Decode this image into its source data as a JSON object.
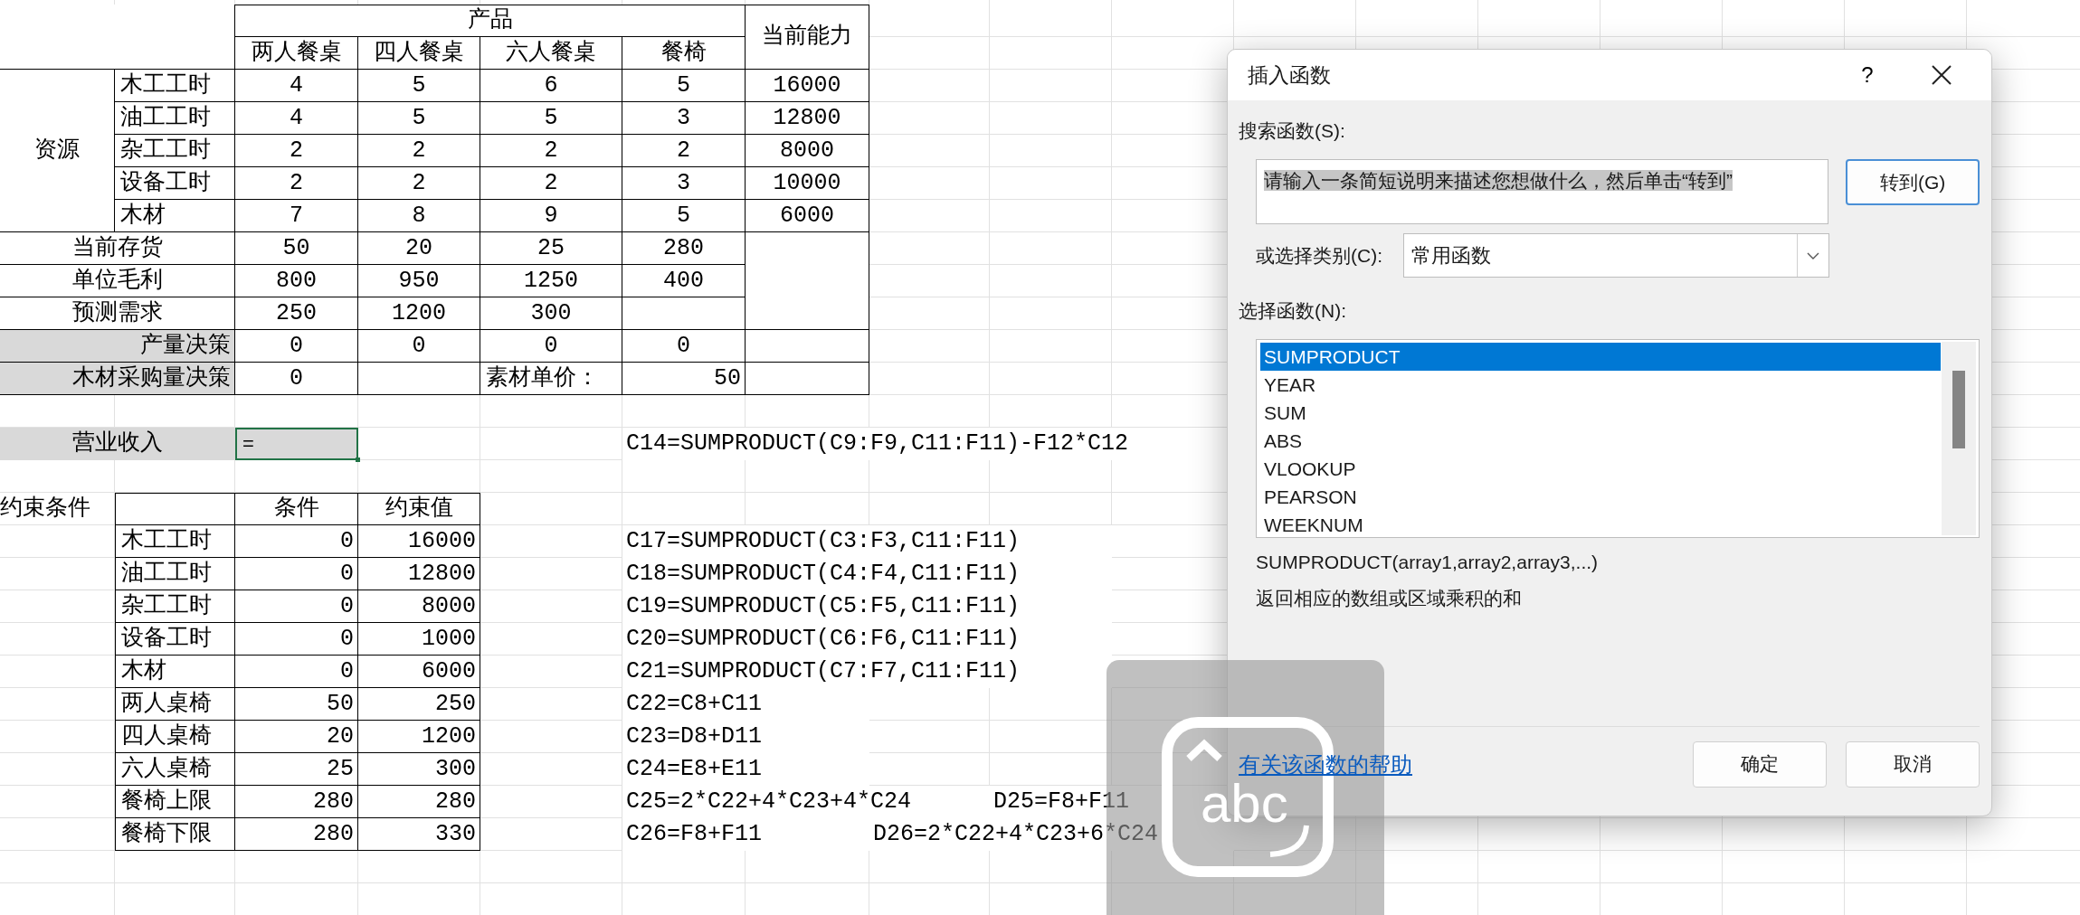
{
  "product_table": {
    "header_group": "产品",
    "capacity_header": "当前能力",
    "products": [
      "两人餐桌",
      "四人餐桌",
      "六人餐桌",
      "餐椅"
    ],
    "resource_group": "资源",
    "resources": [
      {
        "name": "木工工时",
        "values": [
          "4",
          "5",
          "6",
          "5"
        ],
        "capacity": "16000"
      },
      {
        "name": "油工工时",
        "values": [
          "4",
          "5",
          "5",
          "3"
        ],
        "capacity": "12800"
      },
      {
        "name": "杂工工时",
        "values": [
          "2",
          "2",
          "2",
          "2"
        ],
        "capacity": "8000"
      },
      {
        "name": "设备工时",
        "values": [
          "2",
          "2",
          "2",
          "3"
        ],
        "capacity": "10000"
      },
      {
        "name": "木材",
        "values": [
          "7",
          "8",
          "9",
          "5"
        ],
        "capacity": "6000"
      }
    ],
    "metrics": [
      {
        "name": "当前存货",
        "values": [
          "50",
          "20",
          "25",
          "280"
        ]
      },
      {
        "name": "单位毛利",
        "values": [
          "800",
          "950",
          "1250",
          "400"
        ]
      },
      {
        "name": "预测需求",
        "values": [
          "250",
          "1200",
          "300"
        ]
      }
    ],
    "decisions": [
      {
        "name": "产量决策",
        "values": [
          "0",
          "0",
          "0",
          "0"
        ]
      }
    ],
    "wood_purchase": {
      "name": "木材采购量决策",
      "value": "0",
      "price_label": "素材单价：",
      "price": "50"
    }
  },
  "revenue": {
    "label": "营业收入",
    "cell_value": "=",
    "active": true,
    "formula": "C14=SUMPRODUCT(C9:F9,C11:F11)-F12*C12"
  },
  "constraints": {
    "title": "约束条件",
    "columns": [
      "条件",
      "约束值"
    ],
    "rows": [
      {
        "name": "木工工时",
        "condition": "0",
        "limit": "16000",
        "formulas": [
          "C17=SUMPRODUCT(C3:F3,C11:F11)"
        ]
      },
      {
        "name": "油工工时",
        "condition": "0",
        "limit": "12800",
        "formulas": [
          "C18=SUMPRODUCT(C4:F4,C11:F11)"
        ]
      },
      {
        "name": "杂工工时",
        "condition": "0",
        "limit": "8000",
        "formulas": [
          "C19=SUMPRODUCT(C5:F5,C11:F11)"
        ]
      },
      {
        "name": "设备工时",
        "condition": "0",
        "limit": "1000",
        "formulas": [
          "C20=SUMPRODUCT(C6:F6,C11:F11)"
        ]
      },
      {
        "name": "木材",
        "condition": "0",
        "limit": "6000",
        "formulas": [
          "C21=SUMPRODUCT(C7:F7,C11:F11)"
        ]
      },
      {
        "name": "两人桌椅",
        "condition": "50",
        "limit": "250",
        "formulas": [
          "C22=C8+C11"
        ]
      },
      {
        "name": "四人桌椅",
        "condition": "20",
        "limit": "1200",
        "formulas": [
          "C23=D8+D11"
        ]
      },
      {
        "name": "六人桌椅",
        "condition": "25",
        "limit": "300",
        "formulas": [
          "C24=E8+E11"
        ]
      },
      {
        "name": "餐椅上限",
        "condition": "280",
        "limit": "280",
        "formulas": [
          "C25=2*C22+4*C23+4*C24",
          "D25=F8+F11"
        ]
      },
      {
        "name": "餐椅下限",
        "condition": "280",
        "limit": "330",
        "formulas": [
          "C26=F8+F11",
          "D26=2*C22+4*C23+6*C24"
        ]
      }
    ]
  },
  "dialog": {
    "title": "插入函数",
    "help": "?",
    "search_label": "搜索函数(S):",
    "search": {
      "value": "请输入一条简短说明来描述您想做什么，然后单击“转到”",
      "selected": true
    },
    "go_button": {
      "label": "转到(G)",
      "default": true
    },
    "category_label": "或选择类别(C):",
    "category": "常用函数",
    "functions_label": "选择函数(N):",
    "functions": [
      {
        "name": "SUMPRODUCT",
        "selected": true
      },
      {
        "name": "YEAR",
        "selected": false
      },
      {
        "name": "SUM",
        "selected": false
      },
      {
        "name": "ABS",
        "selected": false
      },
      {
        "name": "VLOOKUP",
        "selected": false
      },
      {
        "name": "PEARSON",
        "selected": false
      },
      {
        "name": "WEEKNUM",
        "selected": false
      }
    ],
    "signature": "SUMPRODUCT(array1,array2,array3,...)",
    "description": "返回相应的数组或区域乘积的和",
    "help_link": "有关该函数的帮助",
    "buttons": [
      "确定",
      "取消"
    ]
  },
  "ime_indicator": {
    "label": "abc"
  }
}
